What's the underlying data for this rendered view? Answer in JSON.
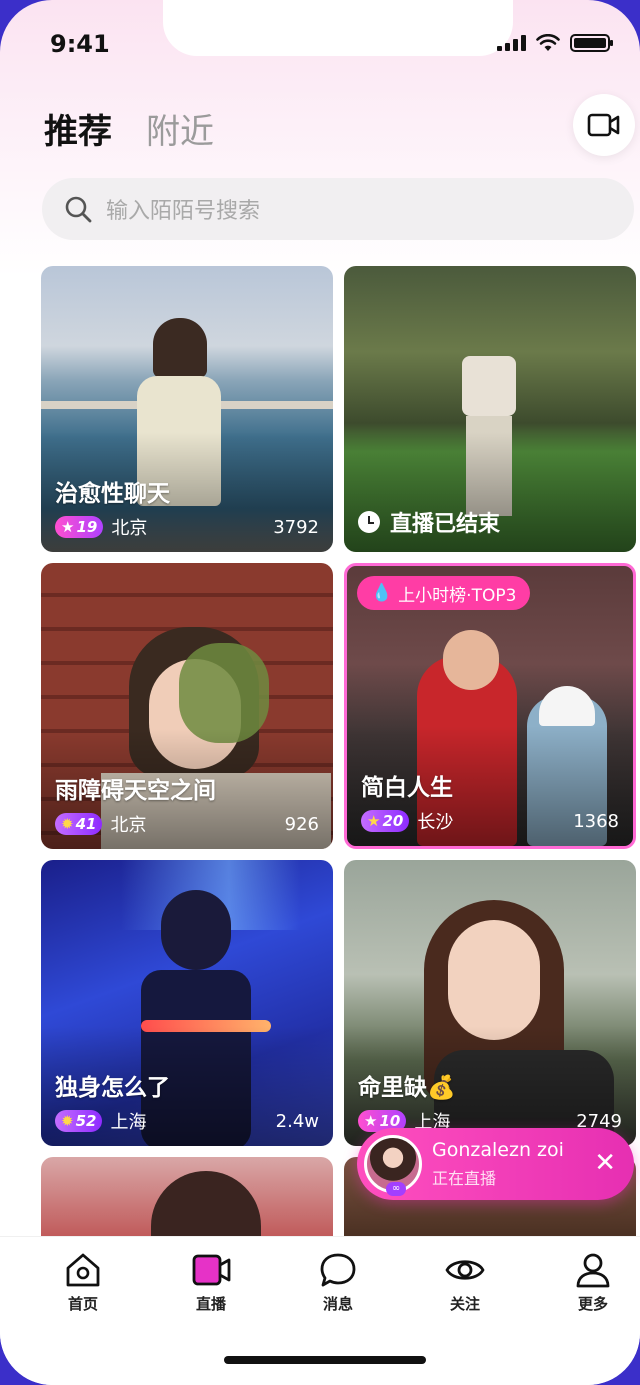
{
  "status_bar": {
    "time": "9:41"
  },
  "header": {
    "tab_recommend": "推荐",
    "tab_nearby": "附近"
  },
  "search": {
    "placeholder": "输入陌陌号搜索"
  },
  "cards": [
    {
      "title": "治愈性聊天",
      "level": "19",
      "city": "北京",
      "views": "3792"
    },
    {
      "status": "直播已结束"
    },
    {
      "title": "雨障碍天空之间",
      "level": "41",
      "city": "北京",
      "views": "926"
    },
    {
      "badge": "上小时榜·TOP3",
      "title": "简白人生",
      "level": "20",
      "city": "长沙",
      "views": "1368"
    },
    {
      "title": "独身怎么了",
      "level": "52",
      "city": "上海",
      "views": "2.4w"
    },
    {
      "title": "命里缺💰",
      "level": "10",
      "city": "上海",
      "views": "2749"
    }
  ],
  "live_toast": {
    "name": "Gonzalezn zoi",
    "status": "正在直播"
  },
  "tabbar": {
    "home": "首页",
    "live": "直播",
    "messages": "消息",
    "follow": "关注",
    "more": "更多"
  },
  "colors": {
    "accent_pink": "#ff3da5",
    "live_tab": "#e632c7"
  }
}
